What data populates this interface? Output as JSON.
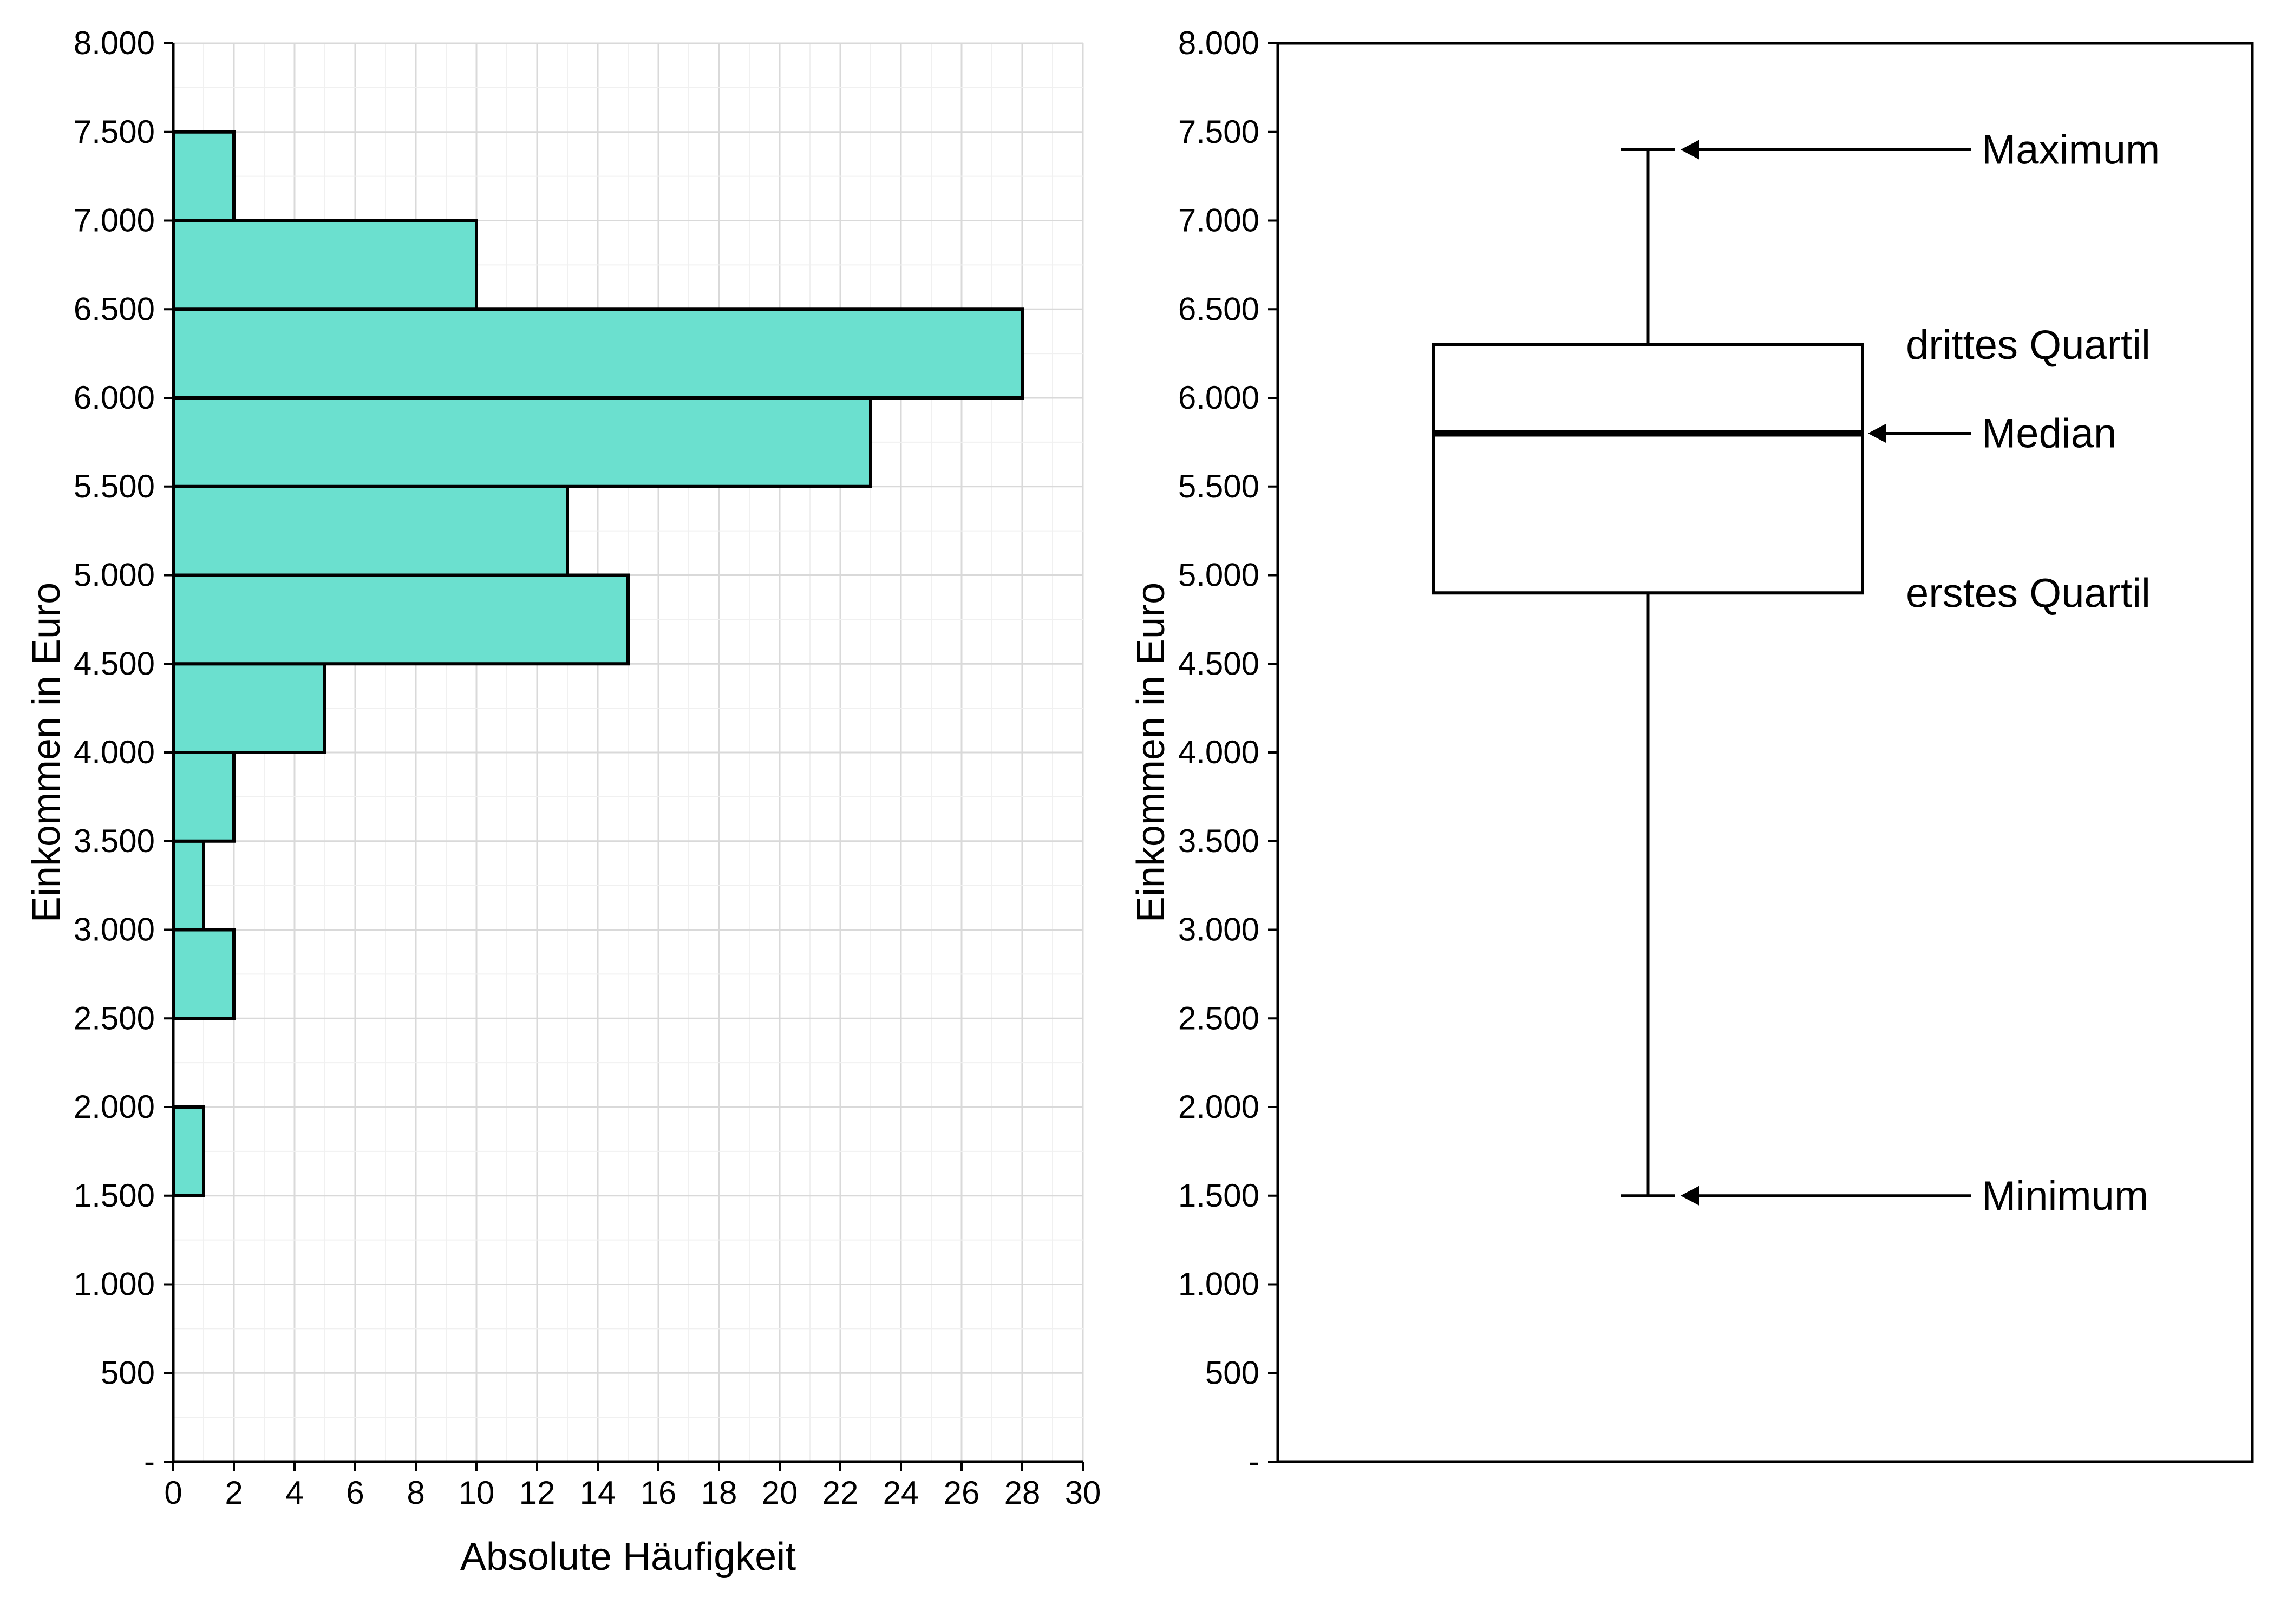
{
  "chart_data": [
    {
      "type": "bar",
      "orientation": "horizontal",
      "xlabel": "Absolute Häufigkeit",
      "ylabel": "Einkommen in Euro",
      "x_ticks": [
        0,
        2,
        4,
        6,
        8,
        10,
        12,
        14,
        16,
        18,
        20,
        22,
        24,
        26,
        28,
        30
      ],
      "y_ticks": [
        "-",
        "500",
        "1.000",
        "1.500",
        "2.000",
        "2.500",
        "3.000",
        "3.500",
        "4.000",
        "4.500",
        "5.000",
        "5.500",
        "6.000",
        "6.500",
        "7.000",
        "7.500",
        "8.000"
      ],
      "y_min": 0,
      "y_max": 8000,
      "x_min": 0,
      "x_max": 30,
      "x_grid_minor_step": 1,
      "y_grid_minor_step": 250,
      "bar_fill": "#6be0cf",
      "bars": [
        {
          "from": 1500,
          "to": 2000,
          "value": 1
        },
        {
          "from": 2500,
          "to": 3000,
          "value": 2
        },
        {
          "from": 3000,
          "to": 3500,
          "value": 1
        },
        {
          "from": 3500,
          "to": 4000,
          "value": 2
        },
        {
          "from": 4000,
          "to": 4500,
          "value": 5
        },
        {
          "from": 4500,
          "to": 5000,
          "value": 15
        },
        {
          "from": 5000,
          "to": 5500,
          "value": 13
        },
        {
          "from": 5500,
          "to": 6000,
          "value": 23
        },
        {
          "from": 6000,
          "to": 6500,
          "value": 28
        },
        {
          "from": 6500,
          "to": 7000,
          "value": 10
        },
        {
          "from": 7000,
          "to": 7500,
          "value": 2
        }
      ]
    },
    {
      "type": "boxplot",
      "ylabel": "Einkommen in Euro",
      "y_ticks": [
        "-",
        "500",
        "1.000",
        "1.500",
        "2.000",
        "2.500",
        "3.000",
        "3.500",
        "4.000",
        "4.500",
        "5.000",
        "5.500",
        "6.000",
        "6.500",
        "7.000",
        "7.500",
        "8.000"
      ],
      "y_min": 0,
      "y_max": 8000,
      "stats": {
        "min": 1500,
        "q1": 4900,
        "median": 5800,
        "q3": 6300,
        "max": 7400
      },
      "annotations": [
        {
          "key": "max",
          "text": "Maximum"
        },
        {
          "key": "q3",
          "text": "drittes Quartil"
        },
        {
          "key": "median",
          "text": "Median"
        },
        {
          "key": "q1",
          "text": "erstes Quartil"
        },
        {
          "key": "min",
          "text": "Minimum"
        }
      ]
    }
  ]
}
